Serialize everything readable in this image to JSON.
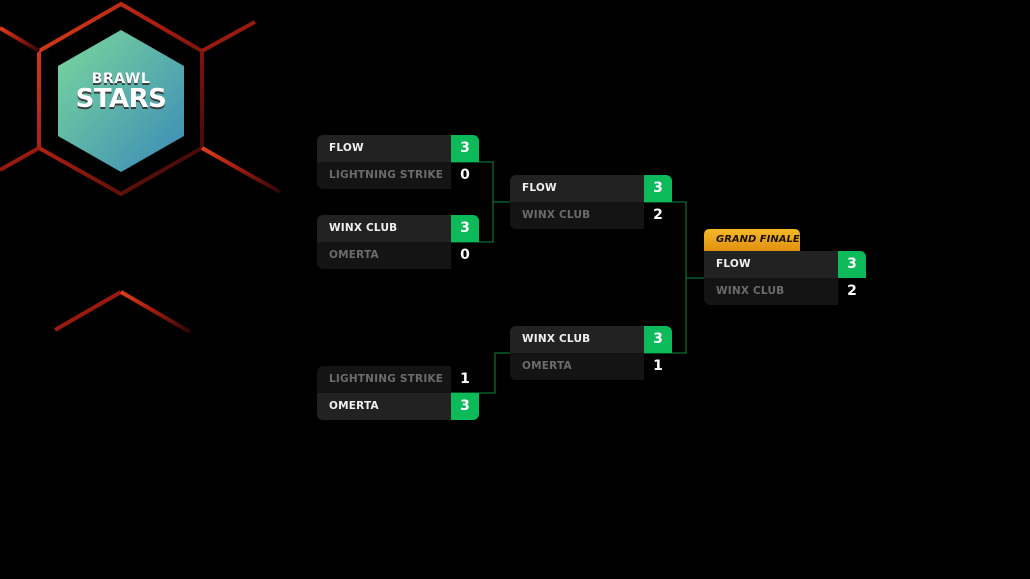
{
  "logo": {
    "line1": "BRAWL",
    "line2": "STARS"
  },
  "colors": {
    "win": "#0dba5a",
    "connector": "#0d8a3e",
    "grand_finale": "#f6b92a",
    "hex_glow": "#d43a10"
  },
  "grand_finale_label": "GRAND FINALE",
  "rounds": {
    "quarter": [
      {
        "teams": [
          {
            "name": "FLOW",
            "score": "3",
            "winner": true
          },
          {
            "name": "LIGHTNING STRIKE",
            "score": "0",
            "winner": false
          }
        ]
      },
      {
        "teams": [
          {
            "name": "WINX CLUB",
            "score": "3",
            "winner": true
          },
          {
            "name": "OMERTA",
            "score": "0",
            "winner": false
          }
        ]
      },
      {
        "teams": [
          {
            "name": "LIGHTNING STRIKE",
            "score": "1",
            "winner": false
          },
          {
            "name": "OMERTA",
            "score": "3",
            "winner": true
          }
        ]
      }
    ],
    "semi": [
      {
        "teams": [
          {
            "name": "FLOW",
            "score": "3",
            "winner": true
          },
          {
            "name": "WINX CLUB",
            "score": "2",
            "winner": false
          }
        ]
      },
      {
        "teams": [
          {
            "name": "WINX CLUB",
            "score": "3",
            "winner": true
          },
          {
            "name": "OMERTA",
            "score": "1",
            "winner": false
          }
        ]
      }
    ],
    "final": [
      {
        "teams": [
          {
            "name": "FLOW",
            "score": "3",
            "winner": true
          },
          {
            "name": "WINX CLUB",
            "score": "2",
            "winner": false
          }
        ]
      }
    ]
  }
}
